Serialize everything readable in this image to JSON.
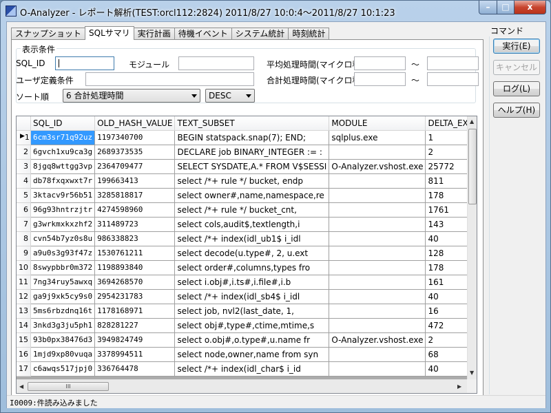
{
  "window": {
    "title": "O-Analyzer - レポート解析(TEST:orcl112:2824) 2011/8/27 10:0:4～2011/8/27 10:1:23",
    "min_glyph": "–",
    "max_glyph": "□",
    "close_glyph": "x"
  },
  "tabs": [
    {
      "label": "スナップショット"
    },
    {
      "label": "SQLサマリ"
    },
    {
      "label": "実行計画"
    },
    {
      "label": "待機イベント"
    },
    {
      "label": "システム統計"
    },
    {
      "label": "時刻統計"
    }
  ],
  "filters": {
    "legend": "表示条件",
    "sql_id_label": "SQL_ID",
    "sql_id_value": "",
    "module_label": "モジュール",
    "module_value": "",
    "avg_time_label": "平均処理時間(マイクロ秒)",
    "total_time_label": "合計処理時間(マイクロ秒)",
    "range_sep": "～",
    "user_cond_label": "ユーザ定義条件",
    "user_cond_value": "",
    "sort_label": "ソート順",
    "sort_value": "6 合計処理時間",
    "order_value": "DESC"
  },
  "grid": {
    "columns": [
      "SQL_ID",
      "OLD_HASH_VALUE",
      "TEXT_SUBSET",
      "MODULE",
      "DELTA_EXE"
    ],
    "rows": [
      [
        "1",
        "6cm3sr71q92uz",
        "1197340700",
        "BEGIN statspack.snap(7); END;",
        "sqlplus.exe",
        "1"
      ],
      [
        "2",
        "6gvch1xu9ca3g",
        "2689373535",
        "DECLARE job BINARY_INTEGER := :",
        "",
        "2"
      ],
      [
        "3",
        "8jgq8wttgg3vp",
        "2364709477",
        "SELECT SYSDATE,A.* FROM V$SESSI",
        "O-Analyzer.vshost.exe",
        "25772"
      ],
      [
        "4",
        "db78fxqxwxt7r",
        "199663413",
        "select /*+ rule */ bucket, endp",
        "",
        "811"
      ],
      [
        "5",
        "3ktacv9r56b51",
        "3285818817",
        "select owner#,name,namespace,re",
        "",
        "178"
      ],
      [
        "6",
        "96g93hntrzjtr",
        "4274598960",
        "select /*+ rule */ bucket_cnt,",
        "",
        "1761"
      ],
      [
        "7",
        "g3wrkmxkxzhf2",
        "311489723",
        "select cols,audit$,textlength,i",
        "",
        "143"
      ],
      [
        "8",
        "cvn54b7yz0s8u",
        "986338823",
        "select /*+ index(idl_ub1$ i_idl",
        "",
        "40"
      ],
      [
        "9",
        "a9u0s3g93f47z",
        "1530761211",
        "select decode(u.type#, 2, u.ext",
        "",
        "128"
      ],
      [
        "10",
        "8swypbbr0m372",
        "1198893840",
        "select order#,columns,types fro",
        "",
        "178"
      ],
      [
        "11",
        "7ng34ruy5awxq",
        "3694268570",
        "select i.obj#,i.ts#,i.file#,i.b",
        "",
        "161"
      ],
      [
        "12",
        "ga9j9xk5cy9s0",
        "2954231783",
        "select /*+ index(idl_sb4$ i_idl",
        "",
        "40"
      ],
      [
        "13",
        "5ms6rbzdnq16t",
        "1178168971",
        "select job, nvl2(last_date, 1,",
        "",
        "16"
      ],
      [
        "14",
        "3nkd3g3ju5ph1",
        "828281227",
        "select obj#,type#,ctime,mtime,s",
        "",
        "472"
      ],
      [
        "15",
        "93b0px38476d3",
        "3949824749",
        "select o.obj#,o.type#,u.name fr",
        "O-Analyzer.vshost.exe",
        "2"
      ],
      [
        "16",
        "1mjd9xp80vuqa",
        "3378994511",
        "select node,owner,name from syn",
        "",
        "68"
      ],
      [
        "17",
        "c6awqs517jpj0",
        "336764478",
        "select /*+ index(idl_char$ i_id",
        "",
        "40"
      ]
    ],
    "row_pointer": "▶",
    "hthumb_grip": "III"
  },
  "commands": {
    "legend": "コマンド",
    "run": "実行(E)",
    "cancel": "キャンセル",
    "log": "ログ(L)",
    "help": "ヘルプ(H)"
  },
  "status": {
    "text": "I0009:件読み込みました"
  }
}
